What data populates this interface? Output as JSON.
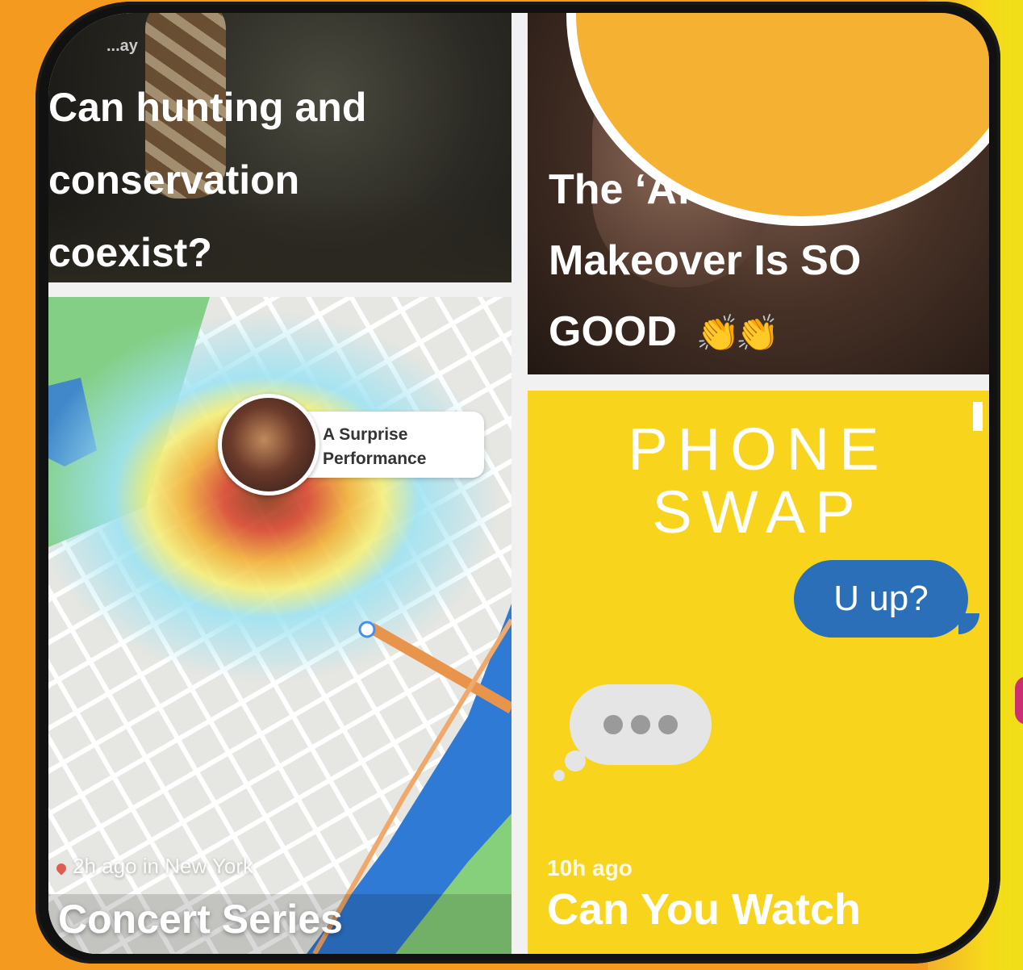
{
  "cards": {
    "hunting": {
      "kicker": "...ay",
      "title": "Can hunting and\nconservation\ncoexist?"
    },
    "makeover": {
      "title": "The ‘After’ of This Makeover Is SO GOOD",
      "emoji": "👏👏"
    },
    "map": {
      "callout_label": "A Surprise Performance",
      "meta": "2h ago in New York",
      "title": "Concert Series"
    },
    "phone_swap": {
      "logo_line1": "PHONE",
      "logo_line2": "SWAP",
      "message": "U up?",
      "meta": "10h ago",
      "title": "Can You Watch"
    }
  },
  "colors": {
    "background": "#f39a1f",
    "phone_swap_yellow": "#f8d51c",
    "message_blue": "#2b6fb8",
    "blob_orange": "#f5b132"
  }
}
